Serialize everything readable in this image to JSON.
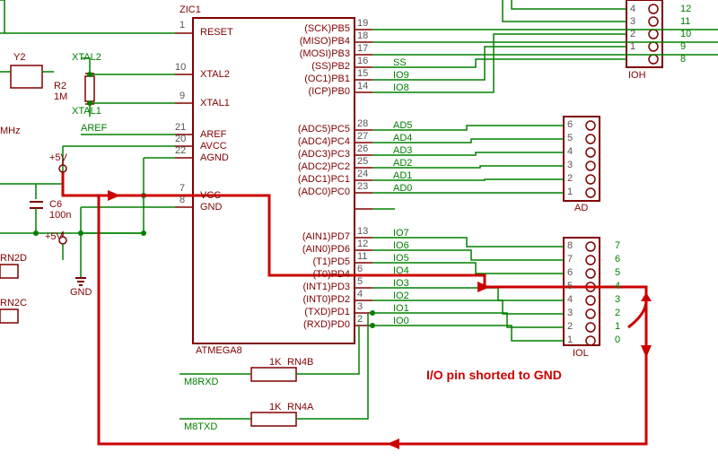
{
  "annotation": "I/O pin shorted to GND",
  "chip": {
    "name": "ATMEGA8",
    "refdes": "ZIC1",
    "left_pins": [
      {
        "n": "1",
        "name": "RESET"
      },
      {
        "n": "10",
        "name": "XTAL2"
      },
      {
        "n": "9",
        "name": "XTAL1"
      },
      {
        "n": "21",
        "name": "AREF"
      },
      {
        "n": "20",
        "name": "AVCC"
      },
      {
        "n": "22",
        "name": "AGND"
      },
      {
        "n": "7",
        "name": "VCC"
      },
      {
        "n": "8",
        "name": "GND"
      }
    ],
    "right_pins_b": [
      {
        "n": "19",
        "name": "(SCK)PB5"
      },
      {
        "n": "18",
        "name": "(MISO)PB4"
      },
      {
        "n": "17",
        "name": "(MOSI)PB3"
      },
      {
        "n": "16",
        "name": "(SS)PB2"
      },
      {
        "n": "15",
        "name": "(OC1)PB1"
      },
      {
        "n": "14",
        "name": "(ICP)PB0"
      }
    ],
    "right_pins_c": [
      {
        "n": "28",
        "name": "(ADC5)PC5"
      },
      {
        "n": "27",
        "name": "(ADC4)PC4"
      },
      {
        "n": "26",
        "name": "(ADC3)PC3"
      },
      {
        "n": "25",
        "name": "(ADC2)PC2"
      },
      {
        "n": "24",
        "name": "(ADC1)PC1"
      },
      {
        "n": "23",
        "name": "(ADC0)PC0"
      }
    ],
    "right_pins_d": [
      {
        "n": "13",
        "name": "(AIN1)PD7"
      },
      {
        "n": "12",
        "name": "(AIN0)PD6"
      },
      {
        "n": "11",
        "name": "(T1)PD5"
      },
      {
        "n": "6",
        "name": "(T0)PD4"
      },
      {
        "n": "5",
        "name": "(INT1)PD3"
      },
      {
        "n": "4",
        "name": "(INT0)PD2"
      },
      {
        "n": "3",
        "name": "(TXD)PD1"
      },
      {
        "n": "2",
        "name": "(RXD)PD0"
      }
    ]
  },
  "nets_b": [
    "",
    "",
    "",
    "SS",
    "IO9",
    "IO8"
  ],
  "nets_c": [
    "AD5",
    "AD4",
    "AD3",
    "AD2",
    "AD1",
    "AD0"
  ],
  "nets_d": [
    "IO7",
    "IO6",
    "IO5",
    "IO4",
    "IO3",
    "IO2",
    "IO1",
    "IO0"
  ],
  "connectors": {
    "ioh": {
      "name": "IOH",
      "pins": [
        "",
        "",
        "",
        "",
        "4",
        "3",
        "2",
        "1"
      ],
      "ext": [
        "",
        "",
        "",
        "12",
        "11",
        "10",
        "9",
        "8"
      ]
    },
    "ad": {
      "name": "AD",
      "pins": [
        "6",
        "5",
        "4",
        "3",
        "2",
        "1"
      ]
    },
    "iol": {
      "name": "IOL",
      "pins": [
        "8",
        "7",
        "6",
        "5",
        "4",
        "3",
        "2",
        "1"
      ],
      "ext": [
        "7",
        "6",
        "5",
        "4",
        "3",
        "2",
        "1",
        "0"
      ]
    }
  },
  "parts": {
    "c6": {
      "ref": "C6",
      "val": "100n"
    },
    "y2": {
      "ref": "Y2"
    },
    "r2": {
      "ref": "R2",
      "val": "1M"
    },
    "rn4a": {
      "ref": "RN4A",
      "val": "1K"
    },
    "rn4b": {
      "ref": "RN4B",
      "val": "1K"
    },
    "rn2c": {
      "ref": "RN2C"
    },
    "rn2d": {
      "ref": "RN2D"
    }
  },
  "power": {
    "p5v": "+5V",
    "gnd": "GND",
    "aref": "AREF",
    "xtal1": "XTAL1",
    "xtal2": "XTAL2",
    "mhz": "MHz"
  },
  "rxtx": {
    "rx": "M8RXD",
    "tx": "M8TXD"
  }
}
